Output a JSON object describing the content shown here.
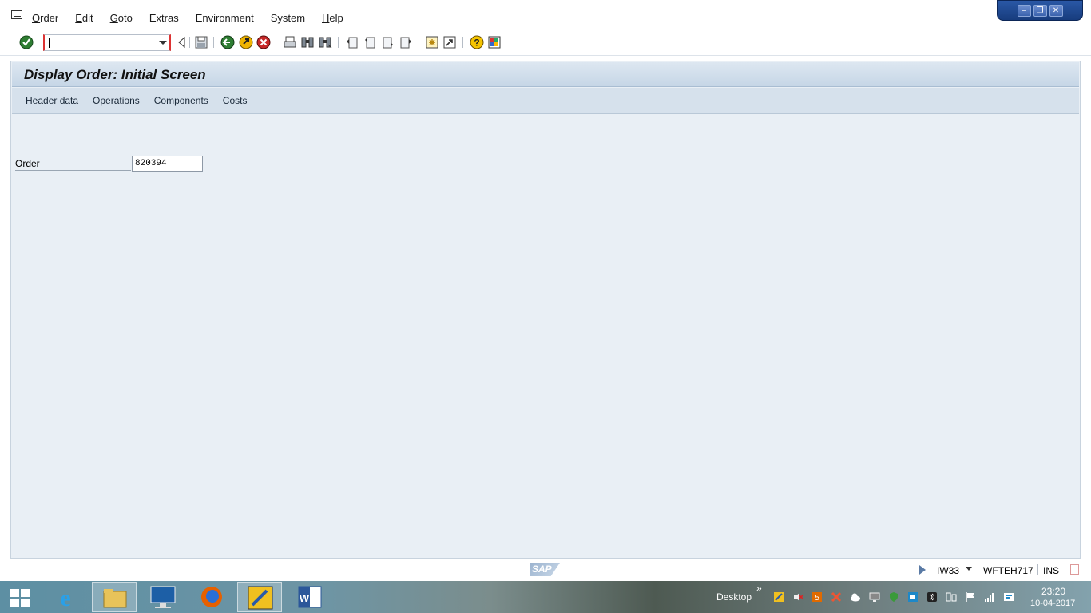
{
  "menubar": {
    "items": [
      {
        "mnemonic": "O",
        "rest": "rder"
      },
      {
        "mnemonic": "E",
        "rest": "dit"
      },
      {
        "mnemonic": "G",
        "rest": "oto"
      },
      {
        "mnemonic": "",
        "rest": "Extras"
      },
      {
        "mnemonic": "",
        "rest": "Environment"
      },
      {
        "mnemonic": "",
        "rest": "System"
      },
      {
        "mnemonic": "H",
        "rest": "elp"
      }
    ]
  },
  "toolbar": {
    "command_field_value": ""
  },
  "screen": {
    "title": "Display Order: Initial Screen",
    "app_buttons": [
      "Header data",
      "Operations",
      "Components",
      "Costs"
    ],
    "order_label": "Order",
    "order_value": "820394"
  },
  "statusbar": {
    "logo": "SAP",
    "transaction": "IW33",
    "system": "WFTEH717",
    "mode": "INS"
  },
  "taskbar": {
    "desktop_label": "Desktop",
    "chevron": "»",
    "time": "23:20",
    "date": "10-04-2017"
  }
}
